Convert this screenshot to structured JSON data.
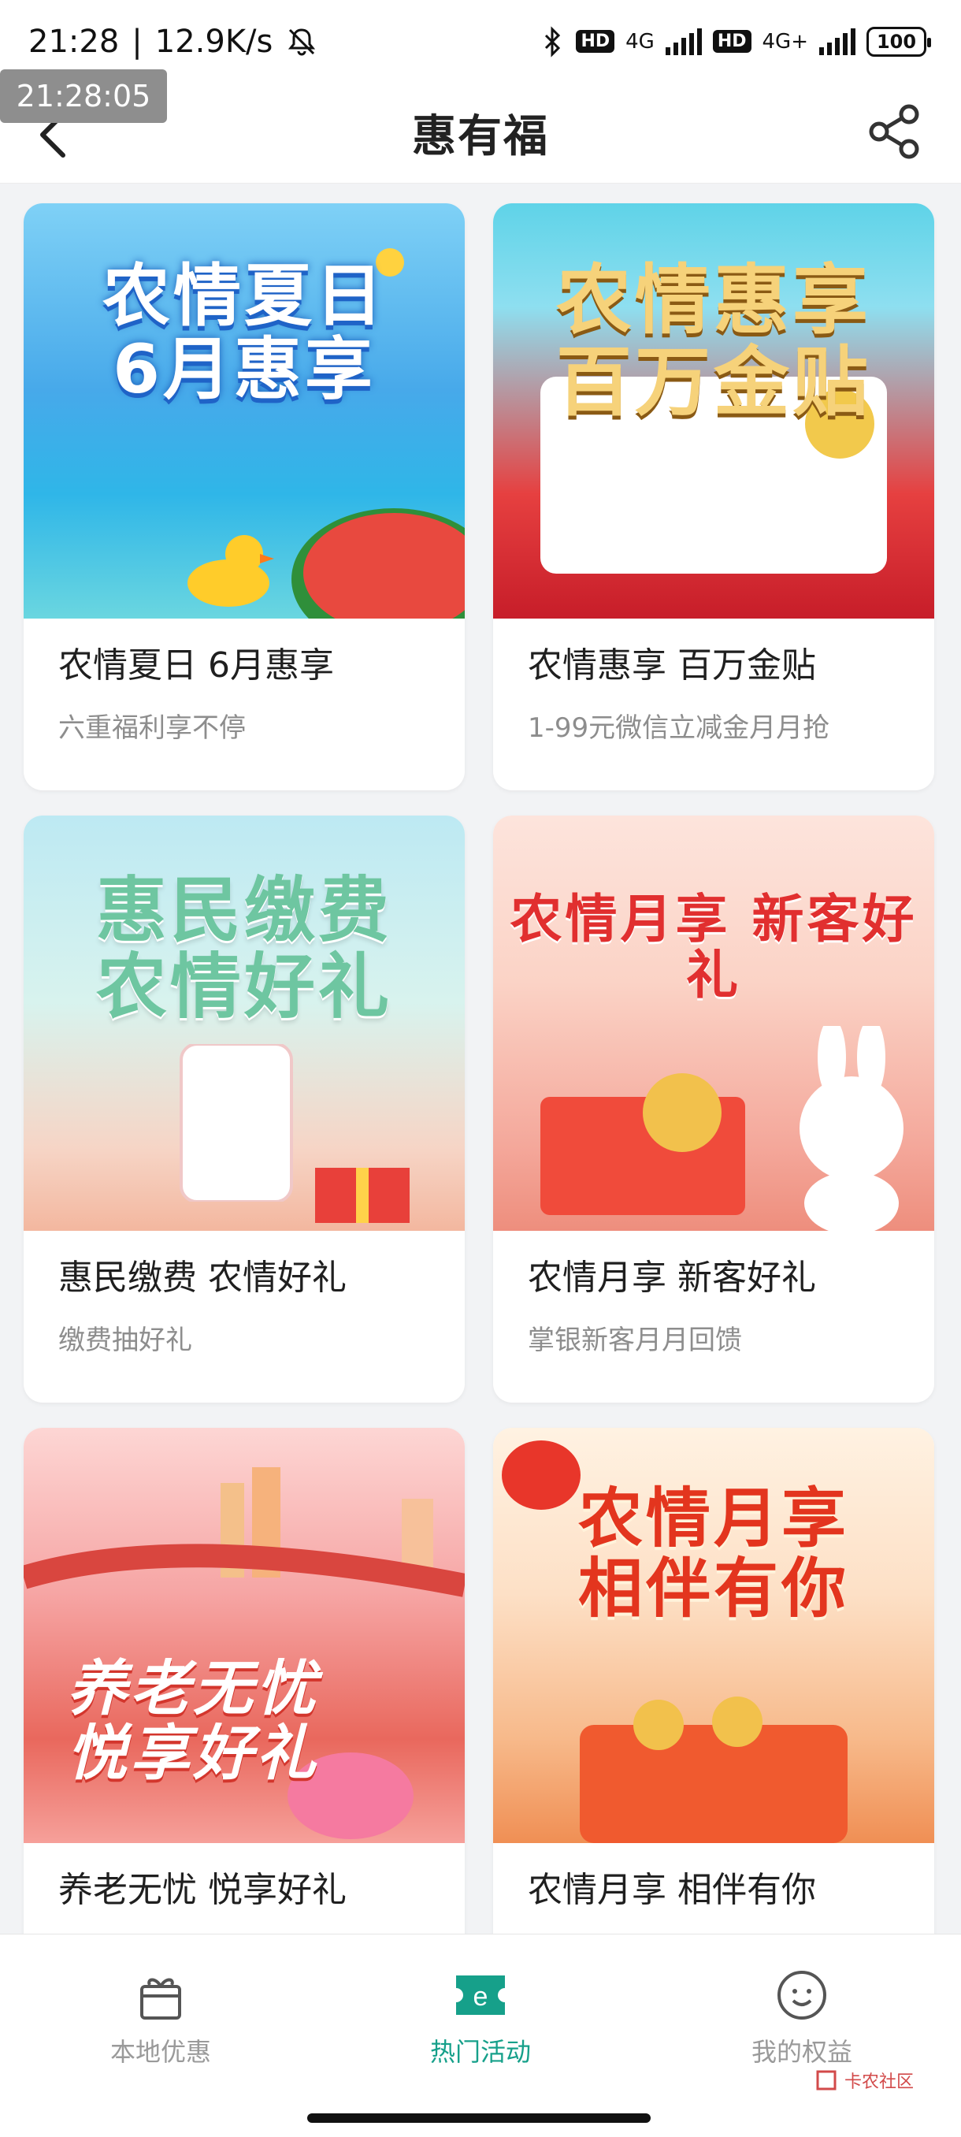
{
  "status": {
    "time": "21:28",
    "speed": "12.9K/s",
    "battery": "100",
    "overlay_time": "21:28:05",
    "net1": "4G",
    "net2": "4G+",
    "hd": "HD"
  },
  "nav": {
    "title": "惠有福"
  },
  "cards": [
    {
      "title": "农情夏日 6月惠享",
      "subtitle": "六重福利享不停",
      "art": "农情夏日\n6月惠享"
    },
    {
      "title": "农情惠享 百万金贴",
      "subtitle": "1-99元微信立减金月月抢",
      "art": "农情惠享\n百万金贴"
    },
    {
      "title": "惠民缴费 农情好礼",
      "subtitle": "缴费抽好礼",
      "art": "惠民缴费\n农情好礼"
    },
    {
      "title": "农情月享 新客好礼",
      "subtitle": "掌银新客月月回馈",
      "art": "农情月享 新客好礼"
    },
    {
      "title": "养老无忧 悦享好礼",
      "subtitle": "",
      "art": "养老无忧\n悦享好礼"
    },
    {
      "title": "农情月享 相伴有你",
      "subtitle": "",
      "art": "农情月享\n相伴有你"
    }
  ],
  "tabbar": {
    "items": [
      {
        "label": "本地优惠",
        "icon": "gift-icon"
      },
      {
        "label": "热门活动",
        "icon": "ticket-e-icon"
      },
      {
        "label": "我的权益",
        "icon": "smile-icon"
      }
    ],
    "active_color": "#16a08a"
  },
  "watermark": "卡农社区"
}
